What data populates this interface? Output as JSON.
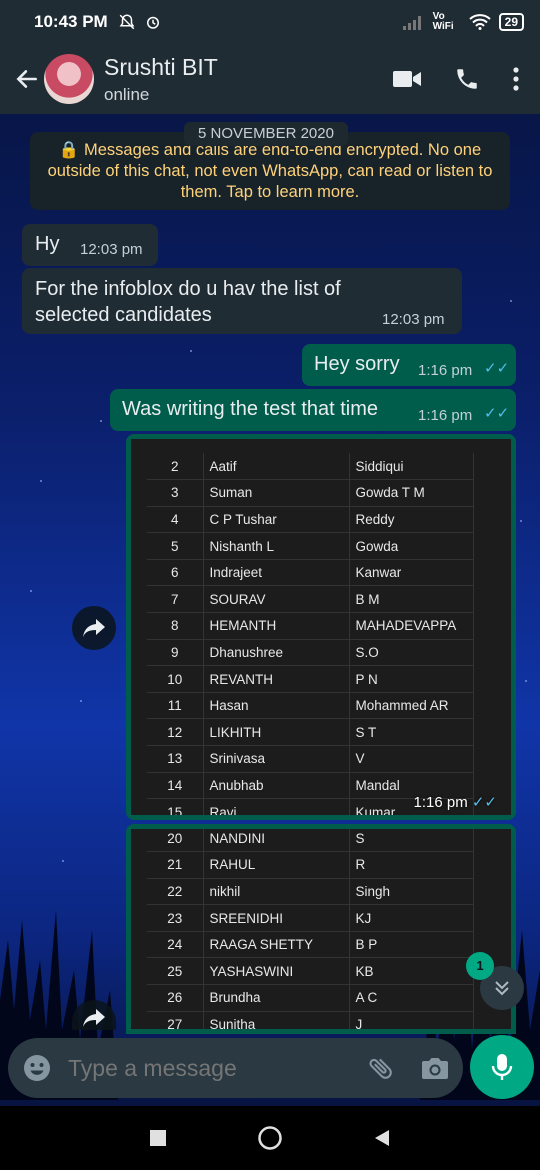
{
  "status_bar": {
    "time": "10:43 PM",
    "network_label": "Vo WiFi",
    "battery": "29"
  },
  "header": {
    "name": "Srushti BIT",
    "status": "online"
  },
  "date_chip": "5 NOVEMBER 2020",
  "encryption_notice": "🔒 Messages and calls are end-to-end encrypted. No one outside of this chat, not even WhatsApp, can read or listen to them. Tap to learn more.",
  "messages": [
    {
      "dir": "in",
      "text": "Hy",
      "time": "12:03 pm"
    },
    {
      "dir": "in",
      "text": "For the infoblox do u hav the list of selected candidates",
      "time": "12:03 pm"
    },
    {
      "dir": "out",
      "text": "Hey sorry",
      "time": "1:16 pm"
    },
    {
      "dir": "out",
      "text": "Was writing the test that time",
      "time": "1:16 pm"
    }
  ],
  "image1": {
    "time": "1:16 pm",
    "rows": [
      [
        "2",
        "Aatif",
        "Siddiqui"
      ],
      [
        "3",
        "Suman",
        "Gowda T M"
      ],
      [
        "4",
        "C P Tushar",
        "Reddy"
      ],
      [
        "5",
        "Nishanth L",
        "Gowda"
      ],
      [
        "6",
        "Indrajeet",
        "Kanwar"
      ],
      [
        "7",
        "SOURAV",
        "B M"
      ],
      [
        "8",
        "HEMANTH",
        "MAHADEVAPPA"
      ],
      [
        "9",
        "Dhanushree",
        "S.O"
      ],
      [
        "10",
        "REVANTH",
        "P N"
      ],
      [
        "11",
        "Hasan",
        "Mohammed AR"
      ],
      [
        "12",
        "LIKHITH",
        "S T"
      ],
      [
        "13",
        "Srinivasa",
        "V"
      ],
      [
        "14",
        "Anubhab",
        "Mandal"
      ],
      [
        "15",
        "Ravi",
        "Kumar"
      ]
    ]
  },
  "image2": {
    "rows": [
      [
        "20",
        "NANDINI",
        "S"
      ],
      [
        "21",
        "RAHUL",
        "R"
      ],
      [
        "22",
        "nikhil",
        "Singh"
      ],
      [
        "23",
        "SREENIDHI",
        "KJ"
      ],
      [
        "24",
        "RAAGA SHETTY",
        "B P"
      ],
      [
        "25",
        "YASHASWINI",
        "KB"
      ],
      [
        "26",
        "Brundha",
        "A C"
      ],
      [
        "27",
        "Sunitha",
        "J"
      ]
    ]
  },
  "unread_count": "1",
  "input": {
    "placeholder": "Type a message"
  },
  "colors": {
    "header": "#1f2c34",
    "outgoing": "#005c4b",
    "incoming": "#202c33",
    "accent": "#00a884",
    "read_ticks": "#53bdeb"
  }
}
